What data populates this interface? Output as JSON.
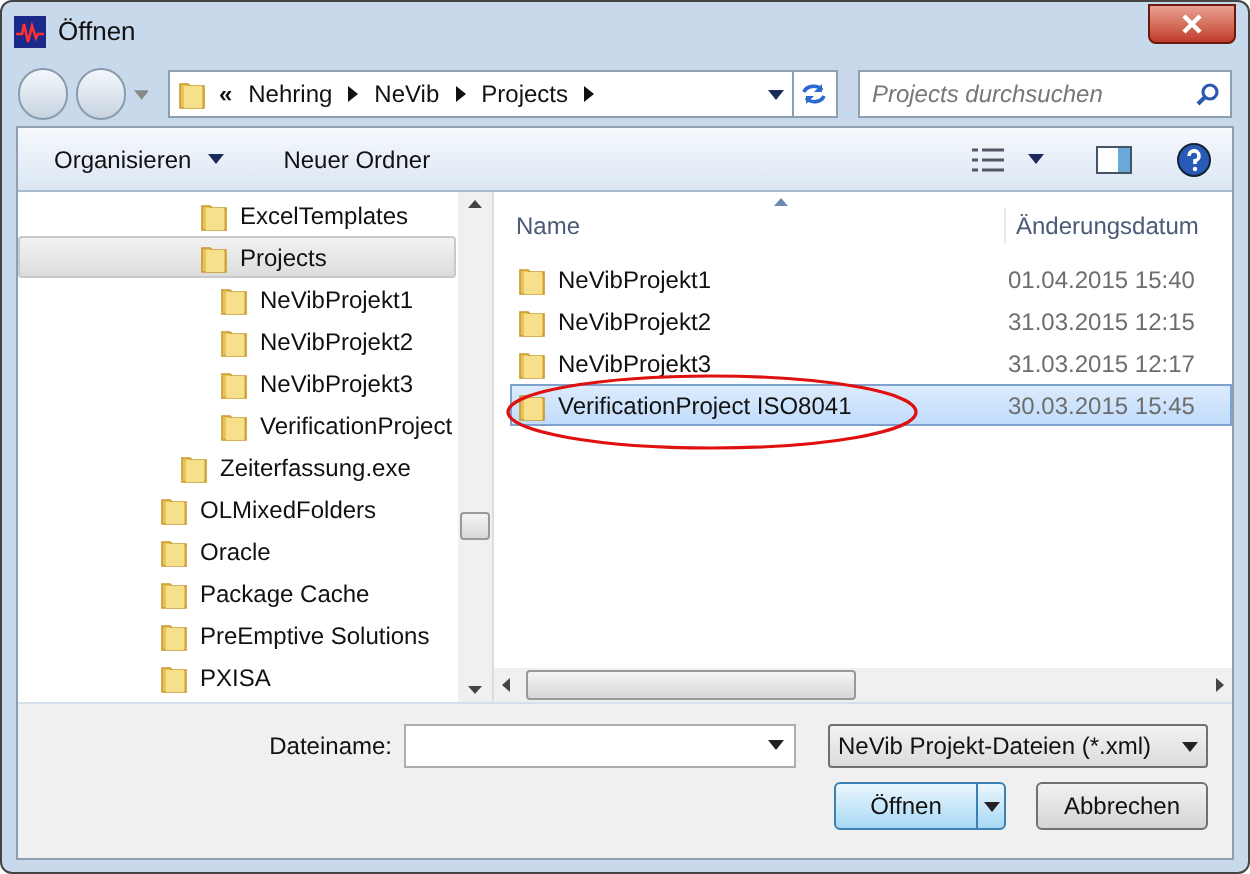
{
  "window": {
    "title": "Öffnen"
  },
  "address_bar": {
    "overflow": "«",
    "crumbs": [
      "Nehring",
      "NeVib",
      "Projects"
    ],
    "search": {
      "placeholder": "Projects durchsuchen"
    }
  },
  "toolbar": {
    "organize": "Organisieren",
    "new_folder": "Neuer Ordner"
  },
  "sidebar": {
    "items": [
      {
        "children": [
          {
            "children": [
              {
                "label": "ExcelTemplates",
                "selected": false
              },
              {
                "label": "Projects",
                "selected": true,
                "children": [
                  {
                    "label": "NeVibProjekt1",
                    "selected": false
                  },
                  {
                    "label": "NeVibProjekt2",
                    "selected": false
                  },
                  {
                    "label": "NeVibProjekt3",
                    "selected": false
                  },
                  {
                    "label": "VerificationProject",
                    "selected": false
                  }
                ]
              }
            ]
          },
          {
            "label": "Zeiterfassung.exe",
            "selected": false
          }
        ]
      },
      {
        "label": "OLMixedFolders",
        "selected": false
      },
      {
        "label": "Oracle",
        "selected": false
      },
      {
        "label": "Package Cache",
        "selected": false
      },
      {
        "label": "PreEmptive Solutions",
        "selected": false
      },
      {
        "label": "PXISA",
        "selected": false
      }
    ]
  },
  "file_list": {
    "columns": [
      "Name",
      "Änderungsdatum"
    ],
    "rows": [
      {
        "name": "NeVibProjekt1",
        "date": "01.04.2015 15:40",
        "selected": false
      },
      {
        "name": "NeVibProjekt2",
        "date": "31.03.2015 12:15",
        "selected": false
      },
      {
        "name": "NeVibProjekt3",
        "date": "31.03.2015 12:17",
        "selected": false
      },
      {
        "name": "VerificationProject ISO8041",
        "date": "30.03.2015 15:45",
        "selected": true
      }
    ]
  },
  "filename": {
    "label": "Dateiname:"
  },
  "filter": {
    "value": "NeVib Projekt-Dateien (*.xml)"
  },
  "buttons": [
    "Öffnen",
    "Abbrechen"
  ]
}
